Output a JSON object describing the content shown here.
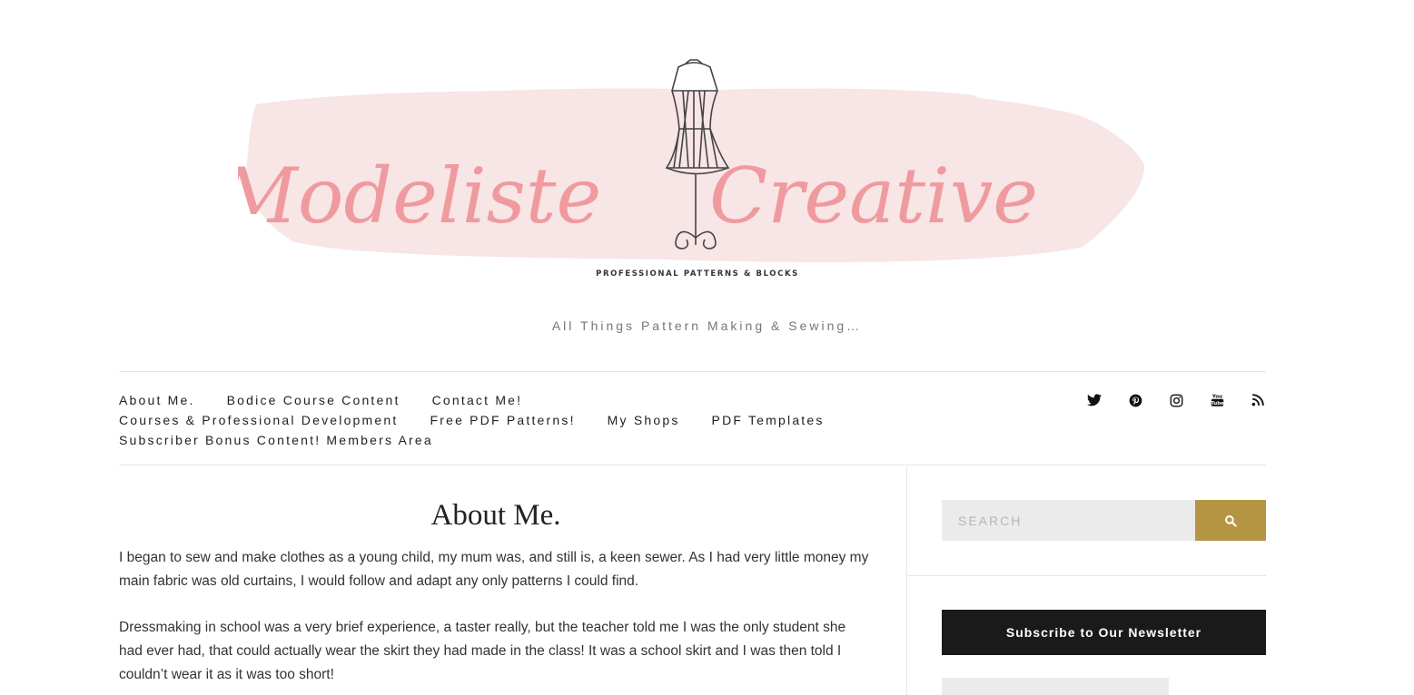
{
  "site": {
    "logo_text": "Modeliste Creative",
    "logo_subtext": "PROFESSIONAL PATTERNS & BLOCKS",
    "tagline": "All Things Pattern Making & Sewing…",
    "colors": {
      "logo_pink": "#ef9a9f",
      "brush_pink": "#f8e5e6",
      "accent_gold": "#b59544",
      "dark": "#1a1a1a"
    }
  },
  "nav": {
    "row1": [
      "About Me.",
      "Bodice Course Content",
      "Contact Me!"
    ],
    "row2": [
      "Courses & Professional Development",
      "Free PDF Patterns!",
      "My Shops",
      "PDF Templates"
    ],
    "row3": [
      "Subscriber Bonus Content! Members Area"
    ]
  },
  "social": [
    "twitter-icon",
    "pinterest-icon",
    "instagram-icon",
    "youtube-icon",
    "rss-icon"
  ],
  "content": {
    "title": "About Me.",
    "paragraphs": [
      "I began to sew and make clothes as a young child, my mum was, and still is, a keen sewer. As I had very little money my main fabric was old curtains, I would follow and adapt any only patterns I could find.",
      "Dressmaking in school was a very brief experience, a taster really, but the teacher told me I was the only student she had ever had, that could actually wear the skirt they had made in the class! It was a school skirt and I was then told I couldn’t wear it as it was too short!"
    ]
  },
  "sidebar": {
    "search_placeholder": "SEARCH",
    "newsletter_label": "Subscribe to Our Newsletter"
  }
}
